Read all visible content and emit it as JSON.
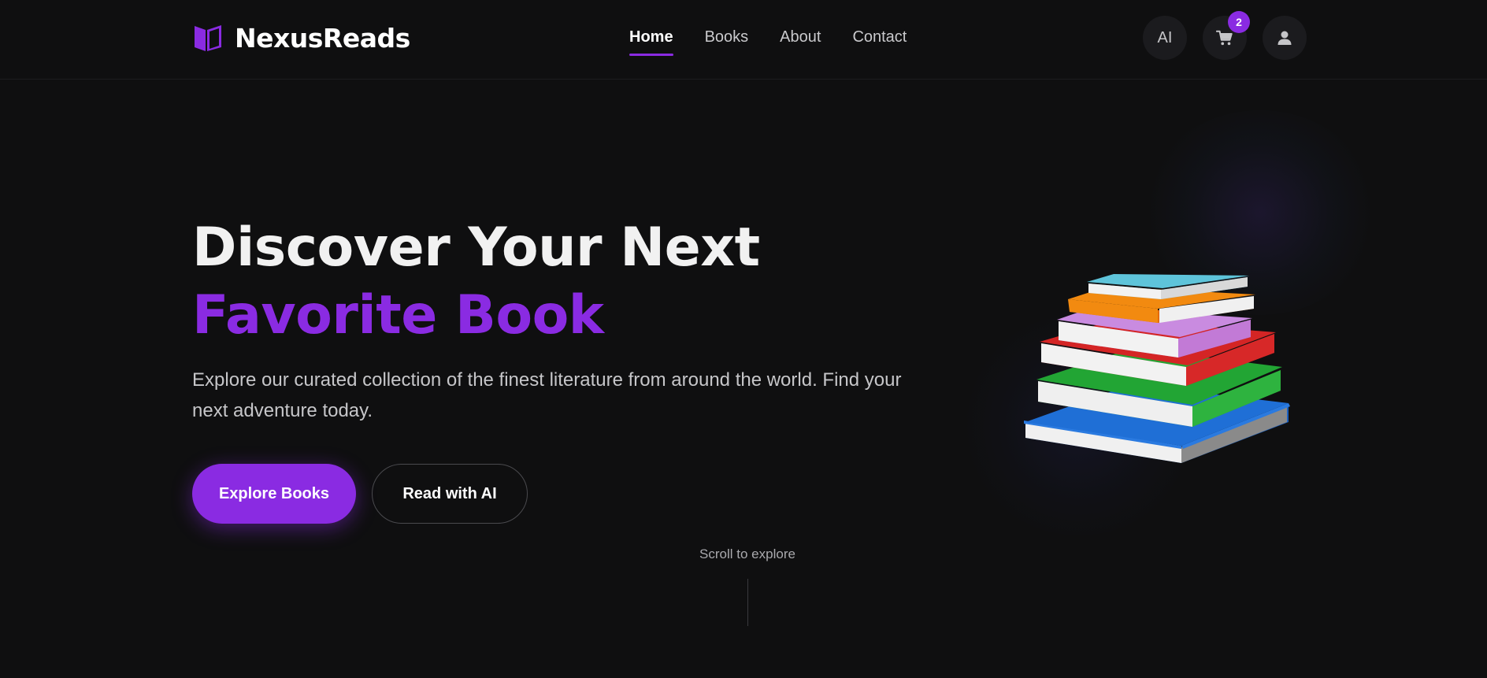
{
  "brand": {
    "name": "NexusReads",
    "accent_color": "#8a2be2"
  },
  "nav": {
    "items": [
      {
        "label": "Home",
        "active": true
      },
      {
        "label": "Books",
        "active": false
      },
      {
        "label": "About",
        "active": false
      },
      {
        "label": "Contact",
        "active": false
      }
    ]
  },
  "header_actions": {
    "ai_label": "AI",
    "cart_icon": "cart-icon",
    "cart_count": "2",
    "user_icon": "user-icon"
  },
  "hero": {
    "title_line1": "Discover Your Next",
    "title_line2": "Favorite Book",
    "description": "Explore our curated collection of the finest literature from around the world. Find your next adventure today.",
    "primary_button": "Explore Books",
    "secondary_button": "Read with AI",
    "illustration_icon": "books-stack-icon"
  },
  "scroll_hint": "Scroll to explore"
}
